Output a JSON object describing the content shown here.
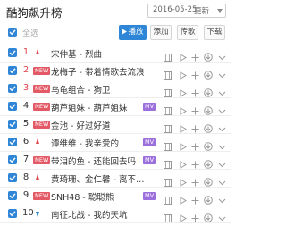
{
  "header": {
    "title": "酷狗飙升榜",
    "date": "2016-05-25",
    "update_label": "更新"
  },
  "toolbar": {
    "select_all": "全选",
    "play": "播放",
    "add": "添加",
    "share": "传歌",
    "download": "下载"
  },
  "colors": {
    "accent": "#2f86d6",
    "hot_rank": "#e0464e",
    "new_badge": "#e35a66",
    "mv_tag": "#9b6fdc"
  },
  "songs": [
    {
      "rank": "1",
      "trend": "up",
      "new": false,
      "title": "宋仲基 - 烈曲",
      "mv": false
    },
    {
      "rank": "2",
      "trend": "new",
      "new": true,
      "badge": "NEW",
      "title": "龙梅子 - 带着情歌去流浪",
      "mv": false
    },
    {
      "rank": "3",
      "trend": "new",
      "new": true,
      "badge": "NEW",
      "title": "乌龟组合 - 狗卫",
      "mv": false
    },
    {
      "rank": "4",
      "trend": "new",
      "new": true,
      "badge": "NEW",
      "title": "葫芦姐妹 - 葫芦姐妹",
      "mv": true,
      "mv_label": "MV"
    },
    {
      "rank": "5",
      "trend": "new",
      "new": true,
      "badge": "NEW",
      "title": "金池 - 好过好道",
      "mv": false
    },
    {
      "rank": "6",
      "trend": "up",
      "new": false,
      "title": "谭维维 - 我亲爱的",
      "mv": true,
      "mv_label": "MV"
    },
    {
      "rank": "7",
      "trend": "new",
      "new": true,
      "badge": "NEW",
      "title": "带泪的鱼 - 还能回去吗",
      "mv": true,
      "mv_label": "MV"
    },
    {
      "rank": "8",
      "trend": "up",
      "new": false,
      "title": "黄琦珊、金仁馨 - 离不…",
      "mv": false
    },
    {
      "rank": "9",
      "trend": "new",
      "new": true,
      "badge": "NEW",
      "title": "SNH48 - 聪聪熊",
      "mv": true,
      "mv_label": "MV"
    },
    {
      "rank": "10",
      "trend": "down",
      "new": false,
      "title": "南征北战 - 我的天坑",
      "mv": false
    }
  ]
}
